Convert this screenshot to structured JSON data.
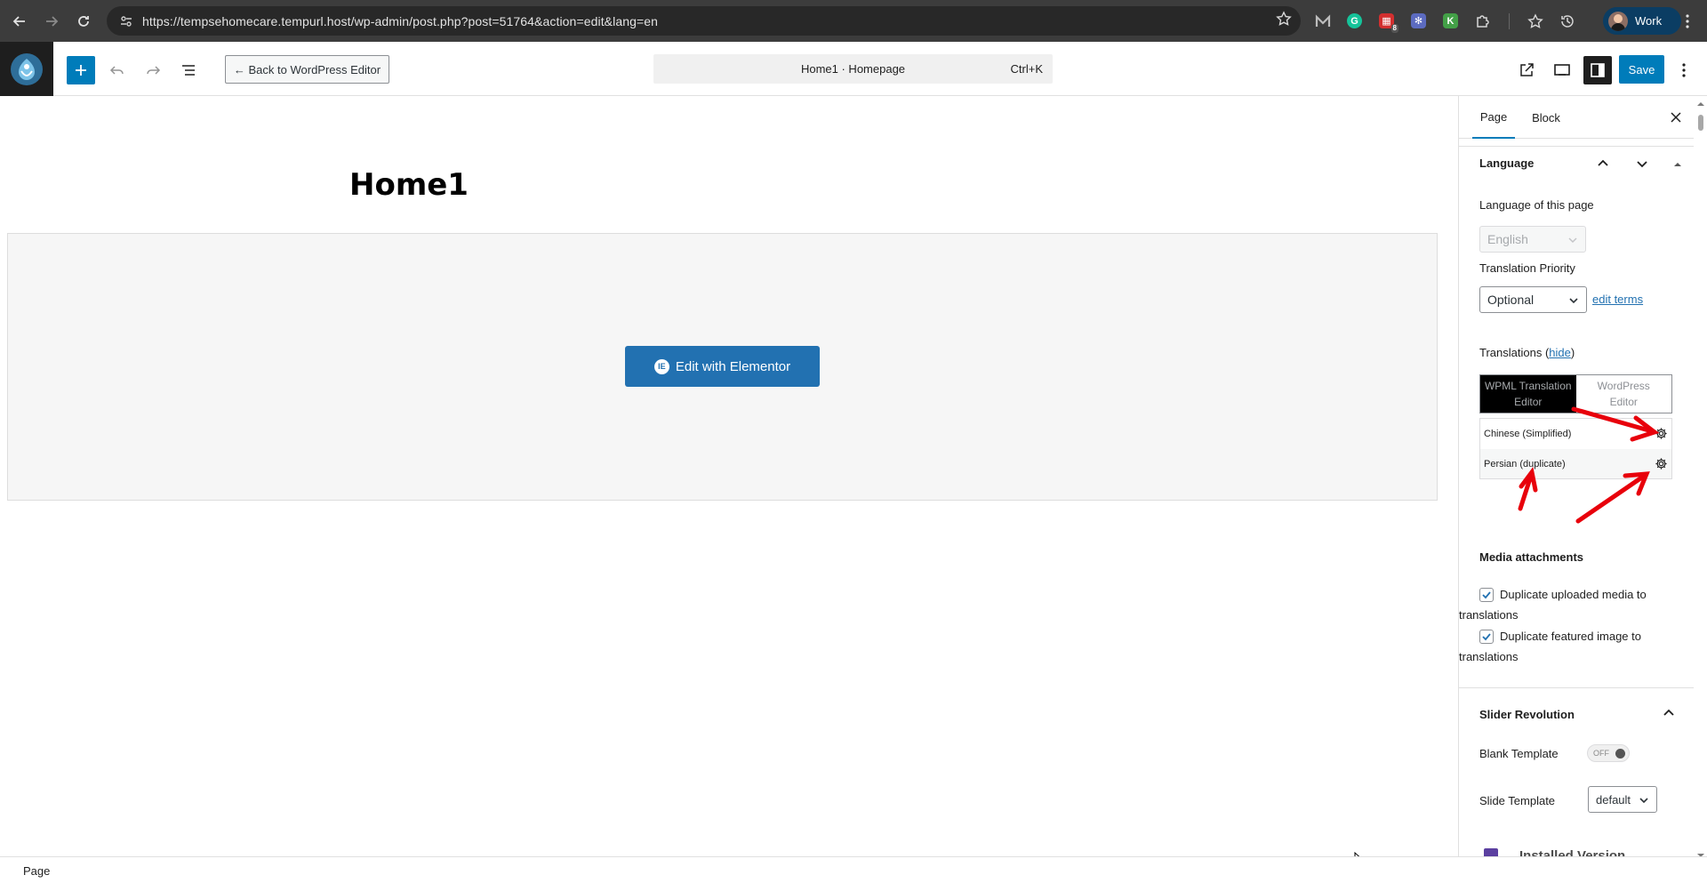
{
  "browser": {
    "url": "https://tempsehomecare.tempurl.host/wp-admin/post.php?post=51764&action=edit&lang=en",
    "profile_label": "Work",
    "ext_badge": "8"
  },
  "toolbar": {
    "back_label": "← Back to WordPress Editor",
    "command_title": "Home1 · Homepage",
    "command_shortcut": "Ctrl+K",
    "save_label": "Save"
  },
  "canvas": {
    "page_title": "Home1",
    "elementor_label": "Edit with Elementor"
  },
  "sidebar": {
    "tabs": [
      {
        "label": "Page"
      },
      {
        "label": "Block"
      }
    ],
    "language": {
      "heading": "Language",
      "lang_label": "Language of this page",
      "lang_value": "English",
      "priority_label": "Translation Priority",
      "priority_value": "Optional",
      "edit_terms": "edit terms",
      "translations_label": "Translations",
      "hide_link": "hide",
      "seg_wpml_line1": "WPML Translation",
      "seg_wpml_line2": "Editor",
      "seg_wp_line1": "WordPress",
      "seg_wp_line2": "Editor",
      "translations": [
        {
          "name": "Chinese (Simplified)"
        },
        {
          "name": "Persian (duplicate)"
        }
      ]
    },
    "media": {
      "heading": "Media attachments",
      "dup_media_line1": "Duplicate uploaded media to",
      "dup_media_line2": "translations",
      "dup_featured_line1": "Duplicate featured image to",
      "dup_featured_line2": "translations"
    },
    "slider": {
      "heading": "Slider Revolution",
      "blank_label": "Blank Template",
      "toggle_text": "OFF",
      "slide_label": "Slide Template",
      "slide_value": "default",
      "installed_label": "Installed Version"
    }
  },
  "footer": {
    "breadcrumb": "Page"
  },
  "colors": {
    "accent": "#007cba",
    "annotation": "#e8000b"
  }
}
